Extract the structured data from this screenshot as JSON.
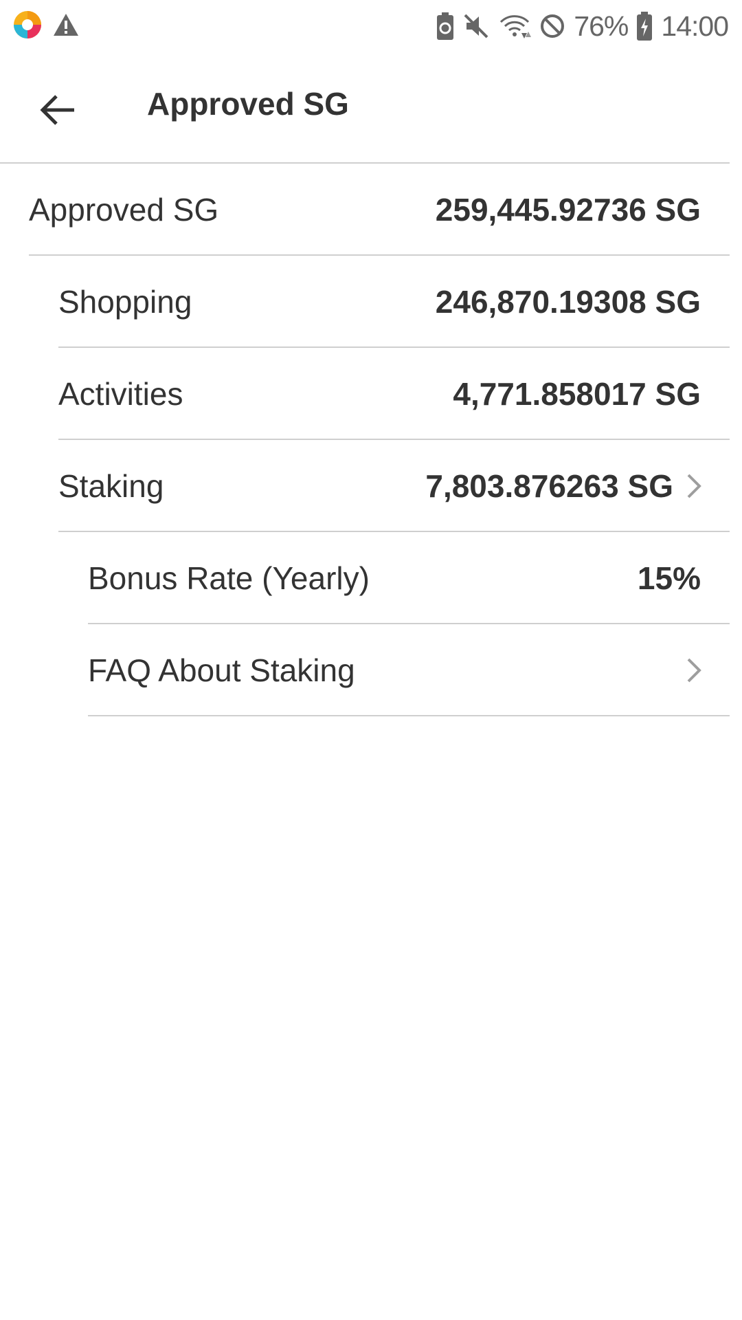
{
  "status_bar": {
    "battery_percent": "76%",
    "time": "14:00",
    "icons": [
      "app-logo-icon",
      "warning-icon",
      "battery-saver-icon",
      "mute-icon",
      "wifi-icon",
      "do-not-disturb-icon",
      "battery-charging-icon"
    ]
  },
  "app_bar": {
    "title": "Approved SG",
    "back_icon": "arrow-left-icon"
  },
  "rows": [
    {
      "label": "Approved SG",
      "value": "259,445.92736 SG"
    },
    {
      "label": "Shopping",
      "value": "246,870.19308 SG"
    },
    {
      "label": "Activities",
      "value": "4,771.858017 SG"
    },
    {
      "label": "Staking",
      "value": "7,803.876263 SG"
    },
    {
      "label": "Bonus Rate (Yearly)",
      "value": "15%"
    },
    {
      "label": "FAQ About Staking",
      "value": ""
    }
  ],
  "colors": {
    "text": "#333333",
    "divider": "#cfcfcf",
    "chevron": "#9e9e9e",
    "status_icons": "#666666"
  }
}
